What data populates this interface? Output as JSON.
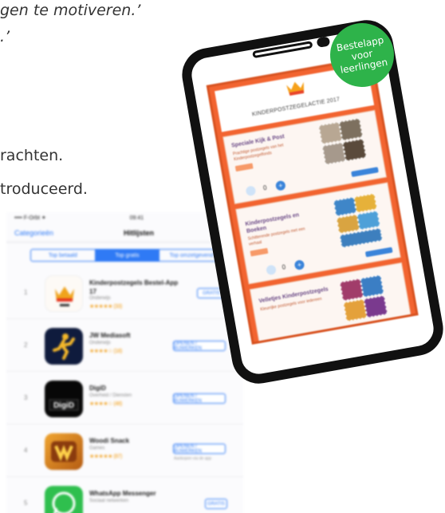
{
  "article": {
    "quote_line1": "gen te motiveren.’",
    "quote_line2": ".’",
    "line3": "rachten.",
    "line4": "troduceerd."
  },
  "ipad": {
    "status": {
      "left": "•••• F-Orbt ✦",
      "time": "09:41",
      "right": "▮ ■"
    },
    "nav": {
      "back": "Categorieën",
      "title": "Hitlijsten"
    },
    "segments": [
      "Top betaald",
      "Top gratis",
      "Top omzetgevend"
    ],
    "apps": [
      {
        "rank": "1",
        "name": "Kinderpostzegels Bestel-App 17",
        "category": "Onderwijs",
        "stars": "★★★★★ (33)",
        "button": "GRATIS",
        "sub": ""
      },
      {
        "rank": "2",
        "name": "JW Mediasoft",
        "category": "Onderwijs",
        "stars": "★★★★☆ (18)",
        "button": "OPENEN / BIJWERKEN",
        "sub": ""
      },
      {
        "rank": "3",
        "name": "DigiD",
        "category": "Overheid / Diensten",
        "stars": "★★★★☆ (48)",
        "button": "OPENEN / BIJWERKEN",
        "sub": ""
      },
      {
        "rank": "4",
        "name": "Woodi Snack",
        "category": "Games",
        "stars": "★★★★★ (87)",
        "button": "OPENEN / BIJWERKEN",
        "sub": "Aankopen via de app"
      },
      {
        "rank": "5",
        "name": "WhatsApp Messenger",
        "category": "Sociaal netwerken",
        "stars": "",
        "button": "GRATIS",
        "sub": ""
      }
    ]
  },
  "phone": {
    "header_title": "KINDERPOSTZEGELACTIE 2017",
    "cards": [
      {
        "title": "Speciale Kijk & Post",
        "sub": "Prachtige postzegels van het Kinderpostzegelfonds"
      },
      {
        "title": "Kinderpostzegels en Boeken",
        "sub": "Schitterende postzegels met een verhaal"
      },
      {
        "title": "Velletjes Kinderpostzegels",
        "sub": "Kleurrijke postzegels voor iedereen"
      }
    ],
    "quantities": [
      "0",
      "0"
    ]
  },
  "badge": {
    "line1": "Bestelapp",
    "line2": "voor",
    "line3": "leerlingen"
  },
  "colors": {
    "accent_blue": "#2f7af5",
    "phone_orange": "#f26430",
    "badge_green": "#2eb34a"
  }
}
